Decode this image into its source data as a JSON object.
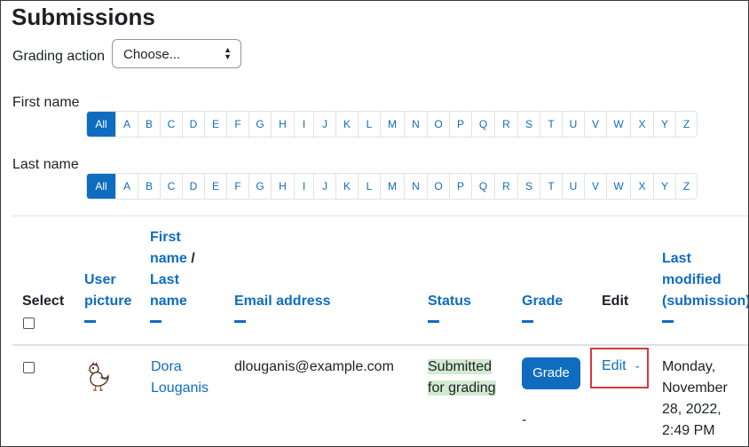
{
  "page": {
    "title": "Submissions"
  },
  "grading_action": {
    "label": "Grading action",
    "selected": "Choose..."
  },
  "initials": {
    "first_name_label": "First name",
    "last_name_label": "Last name",
    "letters": [
      "All",
      "A",
      "B",
      "C",
      "D",
      "E",
      "F",
      "G",
      "H",
      "I",
      "J",
      "K",
      "L",
      "M",
      "N",
      "O",
      "P",
      "Q",
      "R",
      "S",
      "T",
      "U",
      "V",
      "W",
      "X",
      "Y",
      "Z"
    ]
  },
  "table": {
    "headers": {
      "select": "Select",
      "user_picture_1": "User",
      "user_picture_2": "picture",
      "first_name_1": "First",
      "first_name_2": "name",
      "slash": " /",
      "last_name_1": "Last",
      "last_name_2": "name",
      "email": "Email address",
      "status": "Status",
      "grade": "Grade",
      "edit": "Edit",
      "last_modified_1": "Last",
      "last_modified_2": "modified",
      "last_modified_3": "(submission)"
    },
    "rows": [
      {
        "first_name": "Dora",
        "last_name": "Louganis",
        "email": "dlouganis@example.com",
        "status_1": "Submitted",
        "status_2": "for grading",
        "grade_button": "Grade",
        "grade_value": "-",
        "edit": "Edit",
        "modified_1": "Monday,",
        "modified_2": "November",
        "modified_3": "28, 2022,",
        "modified_4": "2:49 PM"
      }
    ]
  },
  "colors": {
    "accent": "#0f6cbf",
    "status_bg": "#d3ebd1",
    "highlight": "#d9363e"
  }
}
